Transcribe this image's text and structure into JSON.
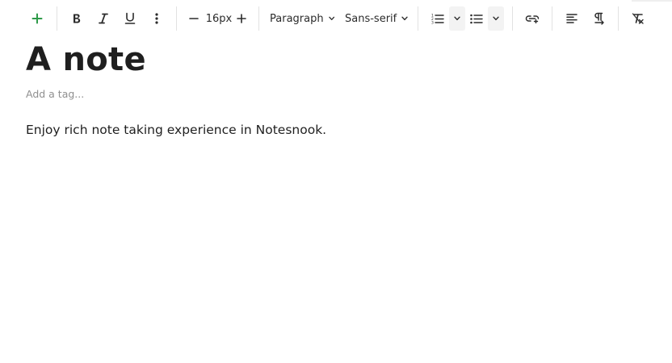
{
  "toolbar": {
    "font_size": "16px",
    "block_type": "Paragraph",
    "font_family": "Sans-serif"
  },
  "accent_color": "#2e9a49",
  "icons": [
    "plus-icon",
    "bold-icon",
    "italic-icon",
    "underline-icon",
    "more-vertical-icon",
    "minus-icon",
    "plus-icon",
    "chevron-down-icon",
    "ordered-list-icon",
    "bullet-list-icon",
    "link-icon",
    "align-left-icon",
    "text-direction-icon",
    "clear-formatting-icon"
  ],
  "note": {
    "title": "A note",
    "tag_placeholder": "Add a tag...",
    "body": "Enjoy rich note taking experience in Notesnook."
  }
}
